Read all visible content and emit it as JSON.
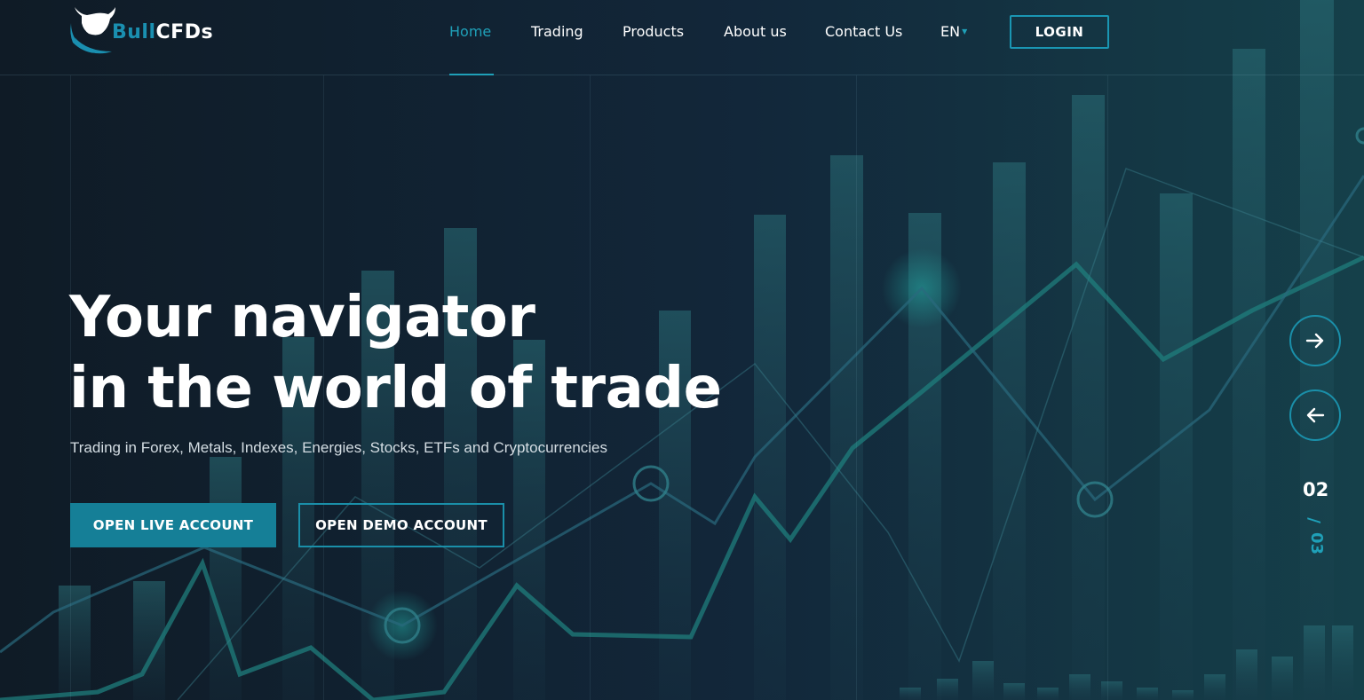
{
  "brand": {
    "name_part1": "Bull",
    "name_part2": "CFDs",
    "logo_icon": "bull-head-icon",
    "accent_color": "#1fa0b8"
  },
  "nav": {
    "items": [
      {
        "label": "Home",
        "active": true
      },
      {
        "label": "Trading",
        "active": false
      },
      {
        "label": "Products",
        "active": false
      },
      {
        "label": "About us",
        "active": false
      },
      {
        "label": "Contact Us",
        "active": false
      }
    ],
    "language": "EN",
    "login_label": "LOGIN"
  },
  "hero": {
    "title_line1": "Your navigator",
    "title_line2": "in the world of trade",
    "subtitle": "Trading in Forex, Metals, Indexes, Energies, Stocks, ETFs and Cryptocurrencies",
    "btn_live": "OPEN LIVE ACCOUNT",
    "btn_demo": "OPEN DEMO ACCOUNT"
  },
  "slider": {
    "next_icon": "arrow-right-icon",
    "prev_icon": "arrow-left-icon",
    "current": "02",
    "separator": "/",
    "total": "03"
  }
}
